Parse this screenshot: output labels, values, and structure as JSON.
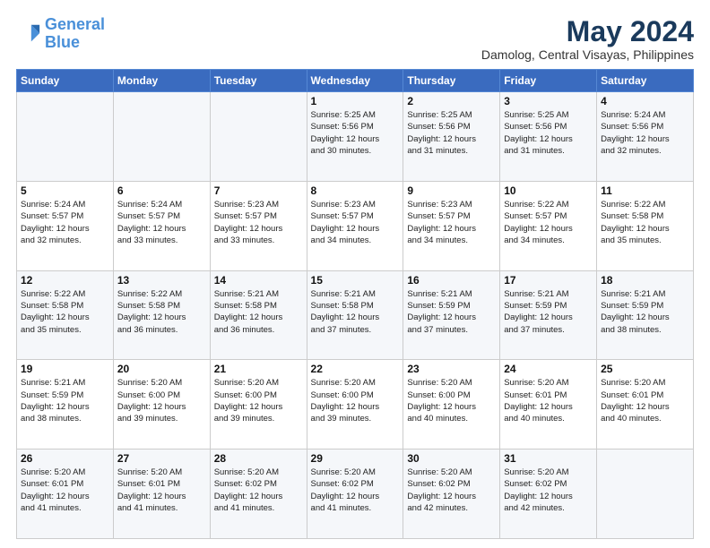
{
  "logo": {
    "line1": "General",
    "line2": "Blue"
  },
  "title": "May 2024",
  "subtitle": "Damolog, Central Visayas, Philippines",
  "weekdays": [
    "Sunday",
    "Monday",
    "Tuesday",
    "Wednesday",
    "Thursday",
    "Friday",
    "Saturday"
  ],
  "weeks": [
    [
      {
        "day": "",
        "info": ""
      },
      {
        "day": "",
        "info": ""
      },
      {
        "day": "",
        "info": ""
      },
      {
        "day": "1",
        "info": "Sunrise: 5:25 AM\nSunset: 5:56 PM\nDaylight: 12 hours\nand 30 minutes."
      },
      {
        "day": "2",
        "info": "Sunrise: 5:25 AM\nSunset: 5:56 PM\nDaylight: 12 hours\nand 31 minutes."
      },
      {
        "day": "3",
        "info": "Sunrise: 5:25 AM\nSunset: 5:56 PM\nDaylight: 12 hours\nand 31 minutes."
      },
      {
        "day": "4",
        "info": "Sunrise: 5:24 AM\nSunset: 5:56 PM\nDaylight: 12 hours\nand 32 minutes."
      }
    ],
    [
      {
        "day": "5",
        "info": "Sunrise: 5:24 AM\nSunset: 5:57 PM\nDaylight: 12 hours\nand 32 minutes."
      },
      {
        "day": "6",
        "info": "Sunrise: 5:24 AM\nSunset: 5:57 PM\nDaylight: 12 hours\nand 33 minutes."
      },
      {
        "day": "7",
        "info": "Sunrise: 5:23 AM\nSunset: 5:57 PM\nDaylight: 12 hours\nand 33 minutes."
      },
      {
        "day": "8",
        "info": "Sunrise: 5:23 AM\nSunset: 5:57 PM\nDaylight: 12 hours\nand 34 minutes."
      },
      {
        "day": "9",
        "info": "Sunrise: 5:23 AM\nSunset: 5:57 PM\nDaylight: 12 hours\nand 34 minutes."
      },
      {
        "day": "10",
        "info": "Sunrise: 5:22 AM\nSunset: 5:57 PM\nDaylight: 12 hours\nand 34 minutes."
      },
      {
        "day": "11",
        "info": "Sunrise: 5:22 AM\nSunset: 5:58 PM\nDaylight: 12 hours\nand 35 minutes."
      }
    ],
    [
      {
        "day": "12",
        "info": "Sunrise: 5:22 AM\nSunset: 5:58 PM\nDaylight: 12 hours\nand 35 minutes."
      },
      {
        "day": "13",
        "info": "Sunrise: 5:22 AM\nSunset: 5:58 PM\nDaylight: 12 hours\nand 36 minutes."
      },
      {
        "day": "14",
        "info": "Sunrise: 5:21 AM\nSunset: 5:58 PM\nDaylight: 12 hours\nand 36 minutes."
      },
      {
        "day": "15",
        "info": "Sunrise: 5:21 AM\nSunset: 5:58 PM\nDaylight: 12 hours\nand 37 minutes."
      },
      {
        "day": "16",
        "info": "Sunrise: 5:21 AM\nSunset: 5:59 PM\nDaylight: 12 hours\nand 37 minutes."
      },
      {
        "day": "17",
        "info": "Sunrise: 5:21 AM\nSunset: 5:59 PM\nDaylight: 12 hours\nand 37 minutes."
      },
      {
        "day": "18",
        "info": "Sunrise: 5:21 AM\nSunset: 5:59 PM\nDaylight: 12 hours\nand 38 minutes."
      }
    ],
    [
      {
        "day": "19",
        "info": "Sunrise: 5:21 AM\nSunset: 5:59 PM\nDaylight: 12 hours\nand 38 minutes."
      },
      {
        "day": "20",
        "info": "Sunrise: 5:20 AM\nSunset: 6:00 PM\nDaylight: 12 hours\nand 39 minutes."
      },
      {
        "day": "21",
        "info": "Sunrise: 5:20 AM\nSunset: 6:00 PM\nDaylight: 12 hours\nand 39 minutes."
      },
      {
        "day": "22",
        "info": "Sunrise: 5:20 AM\nSunset: 6:00 PM\nDaylight: 12 hours\nand 39 minutes."
      },
      {
        "day": "23",
        "info": "Sunrise: 5:20 AM\nSunset: 6:00 PM\nDaylight: 12 hours\nand 40 minutes."
      },
      {
        "day": "24",
        "info": "Sunrise: 5:20 AM\nSunset: 6:01 PM\nDaylight: 12 hours\nand 40 minutes."
      },
      {
        "day": "25",
        "info": "Sunrise: 5:20 AM\nSunset: 6:01 PM\nDaylight: 12 hours\nand 40 minutes."
      }
    ],
    [
      {
        "day": "26",
        "info": "Sunrise: 5:20 AM\nSunset: 6:01 PM\nDaylight: 12 hours\nand 41 minutes."
      },
      {
        "day": "27",
        "info": "Sunrise: 5:20 AM\nSunset: 6:01 PM\nDaylight: 12 hours\nand 41 minutes."
      },
      {
        "day": "28",
        "info": "Sunrise: 5:20 AM\nSunset: 6:02 PM\nDaylight: 12 hours\nand 41 minutes."
      },
      {
        "day": "29",
        "info": "Sunrise: 5:20 AM\nSunset: 6:02 PM\nDaylight: 12 hours\nand 41 minutes."
      },
      {
        "day": "30",
        "info": "Sunrise: 5:20 AM\nSunset: 6:02 PM\nDaylight: 12 hours\nand 42 minutes."
      },
      {
        "day": "31",
        "info": "Sunrise: 5:20 AM\nSunset: 6:02 PM\nDaylight: 12 hours\nand 42 minutes."
      },
      {
        "day": "",
        "info": ""
      }
    ]
  ]
}
